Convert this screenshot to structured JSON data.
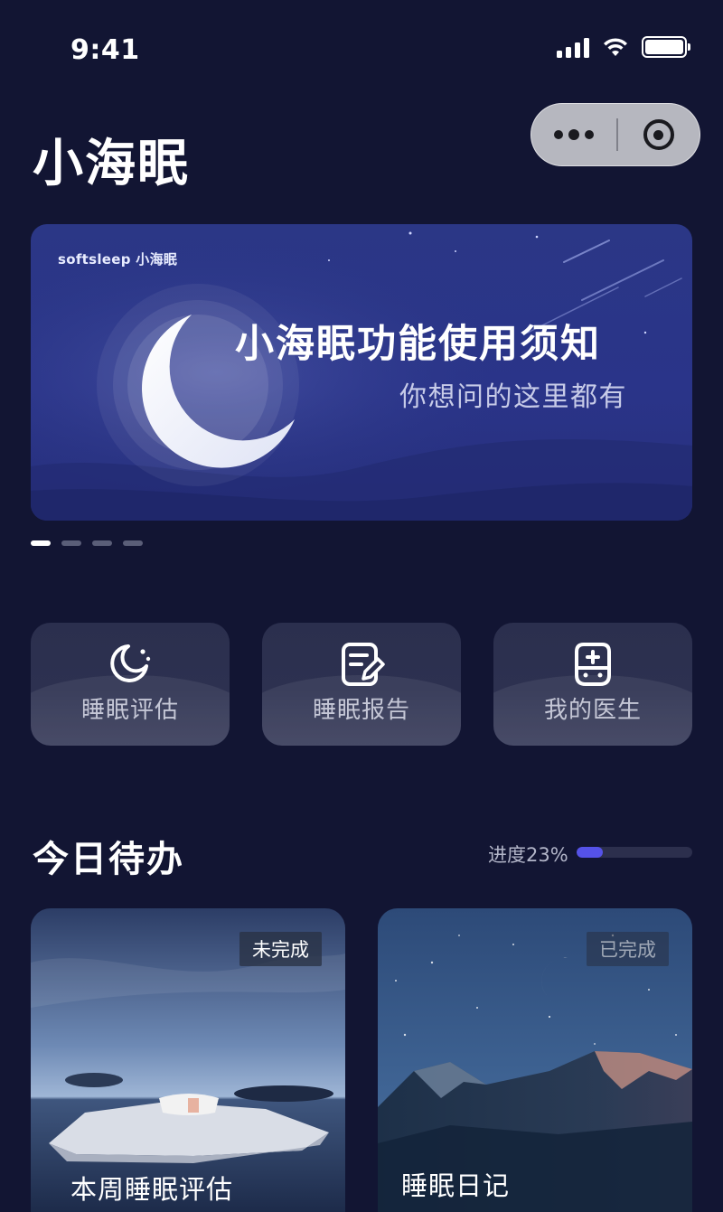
{
  "status_bar": {
    "time": "9:41"
  },
  "header": {
    "title": "小海眠"
  },
  "capsule": {
    "more_icon": "more-dots-icon",
    "close_icon": "target-circle-icon"
  },
  "banner": {
    "brand": "softsleep 小海眠",
    "title": "小海眠功能使用须知",
    "subtitle": "你想问的这里都有",
    "page_count": 4,
    "active_page": 0
  },
  "quick_actions": [
    {
      "label": "睡眠评估",
      "icon": "moon-stars-icon"
    },
    {
      "label": "睡眠报告",
      "icon": "report-edit-icon"
    },
    {
      "label": "我的医生",
      "icon": "doctor-cross-icon"
    }
  ],
  "today": {
    "title": "今日待办",
    "progress_label": "进度23%",
    "progress": 0.23,
    "tasks": [
      {
        "name": "本周睡眠评估",
        "status": "未完成"
      },
      {
        "name": "睡眠日记",
        "status": "已完成"
      }
    ]
  },
  "colors": {
    "background": "#121533",
    "accent": "#5552e8",
    "banner": "#2b3786"
  }
}
